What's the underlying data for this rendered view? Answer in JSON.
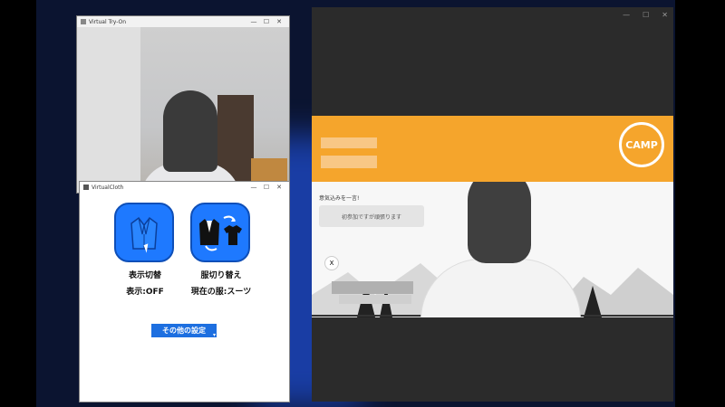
{
  "tryon_window": {
    "title": "Virtual Try-On",
    "controls": [
      "—",
      "☐",
      "✕"
    ]
  },
  "cloth_window": {
    "title": "VirtualCloth",
    "controls": [
      "—",
      "☐",
      "✕"
    ],
    "display_toggle_label": "表示切替",
    "display_status": "表示:OFF",
    "change_clothes_label": "服切り替え",
    "current_clothes": "現在の服:スーツ",
    "settings_button": "その他の設定"
  },
  "meeting_window": {
    "controls": [
      "—",
      "☐",
      "✕"
    ],
    "logo_text": "CAMP",
    "chat_prompt": "意気込みを一言!",
    "chat_message": "初参加ですが頑張ります",
    "x_icon_glyph": "X"
  },
  "colors": {
    "accent_blue": "#1e79ff",
    "banner_orange": "#f5a52c",
    "meeting_bg": "#2b2b2b"
  }
}
